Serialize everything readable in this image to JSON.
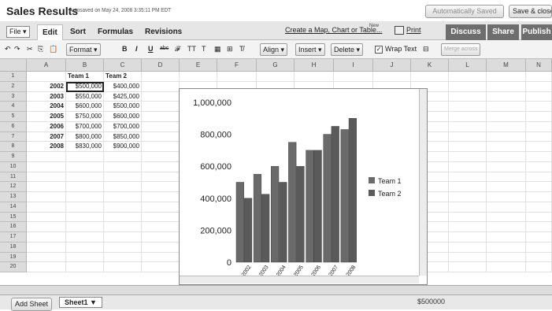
{
  "header": {
    "title": "Sales Results",
    "autosave_note": "Autosaved on May 24, 2008 3:35:11 PM EDT",
    "autosaved_btn": "Automatically Saved",
    "save_close": "Save & close"
  },
  "menu": {
    "file": "File ▾",
    "tabs": [
      "Edit",
      "Sort",
      "Formulas",
      "Revisions"
    ],
    "create_link": "Create a Map, Chart or Table...",
    "new_badge": "New",
    "print": "Print",
    "discuss": "Discuss",
    "share": "Share",
    "publish": "Publish"
  },
  "toolbar": {
    "format": "Format ▾",
    "bold": "B",
    "italic": "I",
    "underline": "U",
    "strike": "abc",
    "align": "Align ▾",
    "insert": "Insert ▾",
    "delete": "Delete ▾",
    "wrap": "Wrap Text",
    "merge": "Merge across"
  },
  "columns": [
    "A",
    "B",
    "C",
    "D",
    "E",
    "F",
    "G",
    "H",
    "I",
    "J",
    "K",
    "L",
    "M",
    "N"
  ],
  "rows": [
    "1",
    "2",
    "3",
    "4",
    "5",
    "6",
    "7",
    "8",
    "9",
    "10",
    "11",
    "12",
    "13",
    "14",
    "15",
    "16",
    "17",
    "18",
    "19",
    "20"
  ],
  "table": {
    "headers": [
      "Team 1",
      "Team 2"
    ],
    "data": [
      [
        "2002",
        "$500,000",
        "$400,000"
      ],
      [
        "2003",
        "$550,000",
        "$425,000"
      ],
      [
        "2004",
        "$600,000",
        "$500,000"
      ],
      [
        "2005",
        "$750,000",
        "$600,000"
      ],
      [
        "2006",
        "$700,000",
        "$700,000"
      ],
      [
        "2007",
        "$800,000",
        "$850,000"
      ],
      [
        "2008",
        "$830,000",
        "$900,000"
      ]
    ]
  },
  "chart_data": {
    "type": "bar",
    "categories": [
      "2002",
      "2003",
      "2004",
      "2005",
      "2006",
      "2007",
      "2008"
    ],
    "series": [
      {
        "name": "Team 1",
        "values": [
          500000,
          550000,
          600000,
          750000,
          700000,
          800000,
          830000
        ],
        "color": "#6a6a6a"
      },
      {
        "name": "Team 2",
        "values": [
          400000,
          425000,
          500000,
          600000,
          700000,
          850000,
          900000
        ],
        "color": "#5a5a5a"
      }
    ],
    "yticks": [
      "0",
      "200,000",
      "400,000",
      "600,000",
      "800,000",
      "1,000,000"
    ],
    "ylim": [
      0,
      1000000
    ],
    "legend": "right"
  },
  "footer": {
    "add_sheet": "Add Sheet",
    "sheet_tab": "Sheet1 ▼",
    "cell_value": "$500000"
  }
}
